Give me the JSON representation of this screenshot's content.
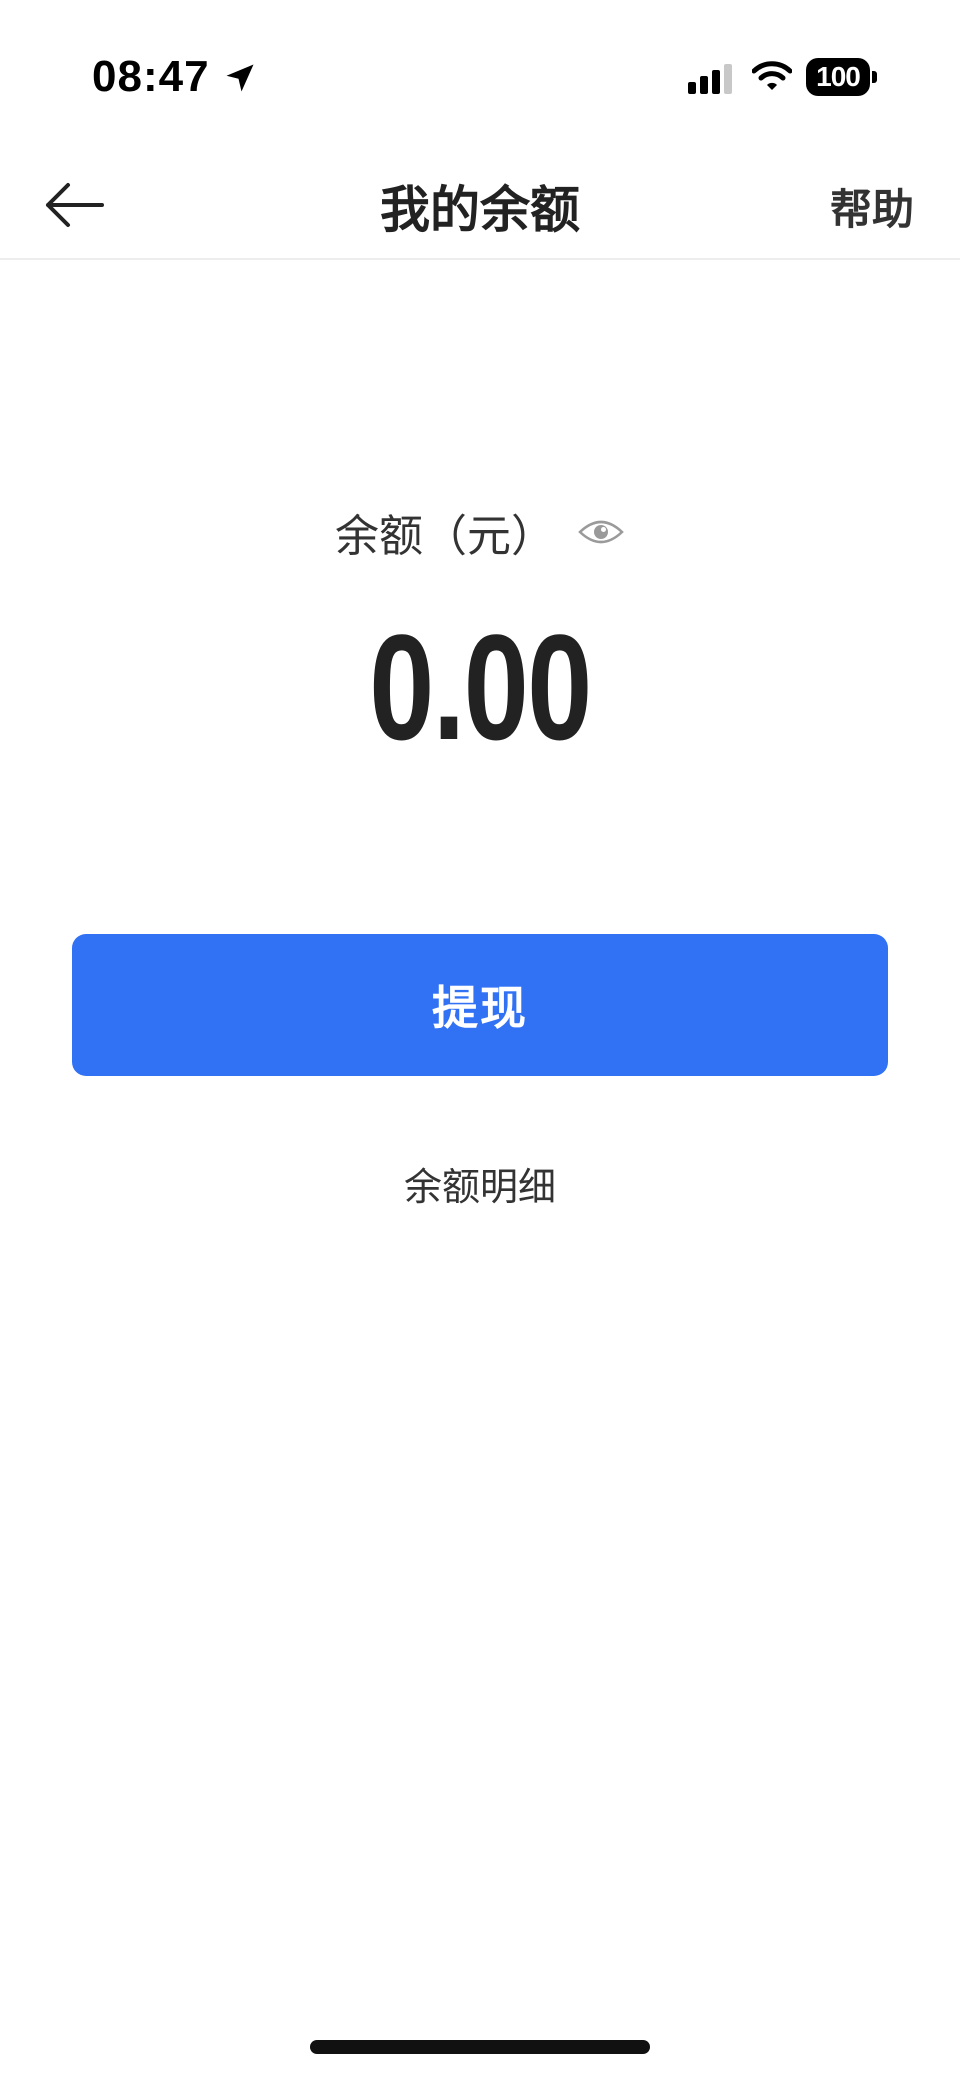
{
  "status_bar": {
    "time": "08:47",
    "battery": "100",
    "icons": [
      "location-arrow-icon",
      "signal-icon",
      "wifi-icon",
      "battery-icon"
    ]
  },
  "nav": {
    "title": "我的余额",
    "help": "帮助",
    "back_icon": "back-arrow-icon"
  },
  "balance": {
    "label": "余额（元）",
    "amount": "0.00",
    "visibility_icon": "eye-icon"
  },
  "actions": {
    "withdraw": "提现",
    "details": "余额明细"
  },
  "colors": {
    "primary": "#3172f5",
    "text": "#222222",
    "divider": "#ededed"
  }
}
